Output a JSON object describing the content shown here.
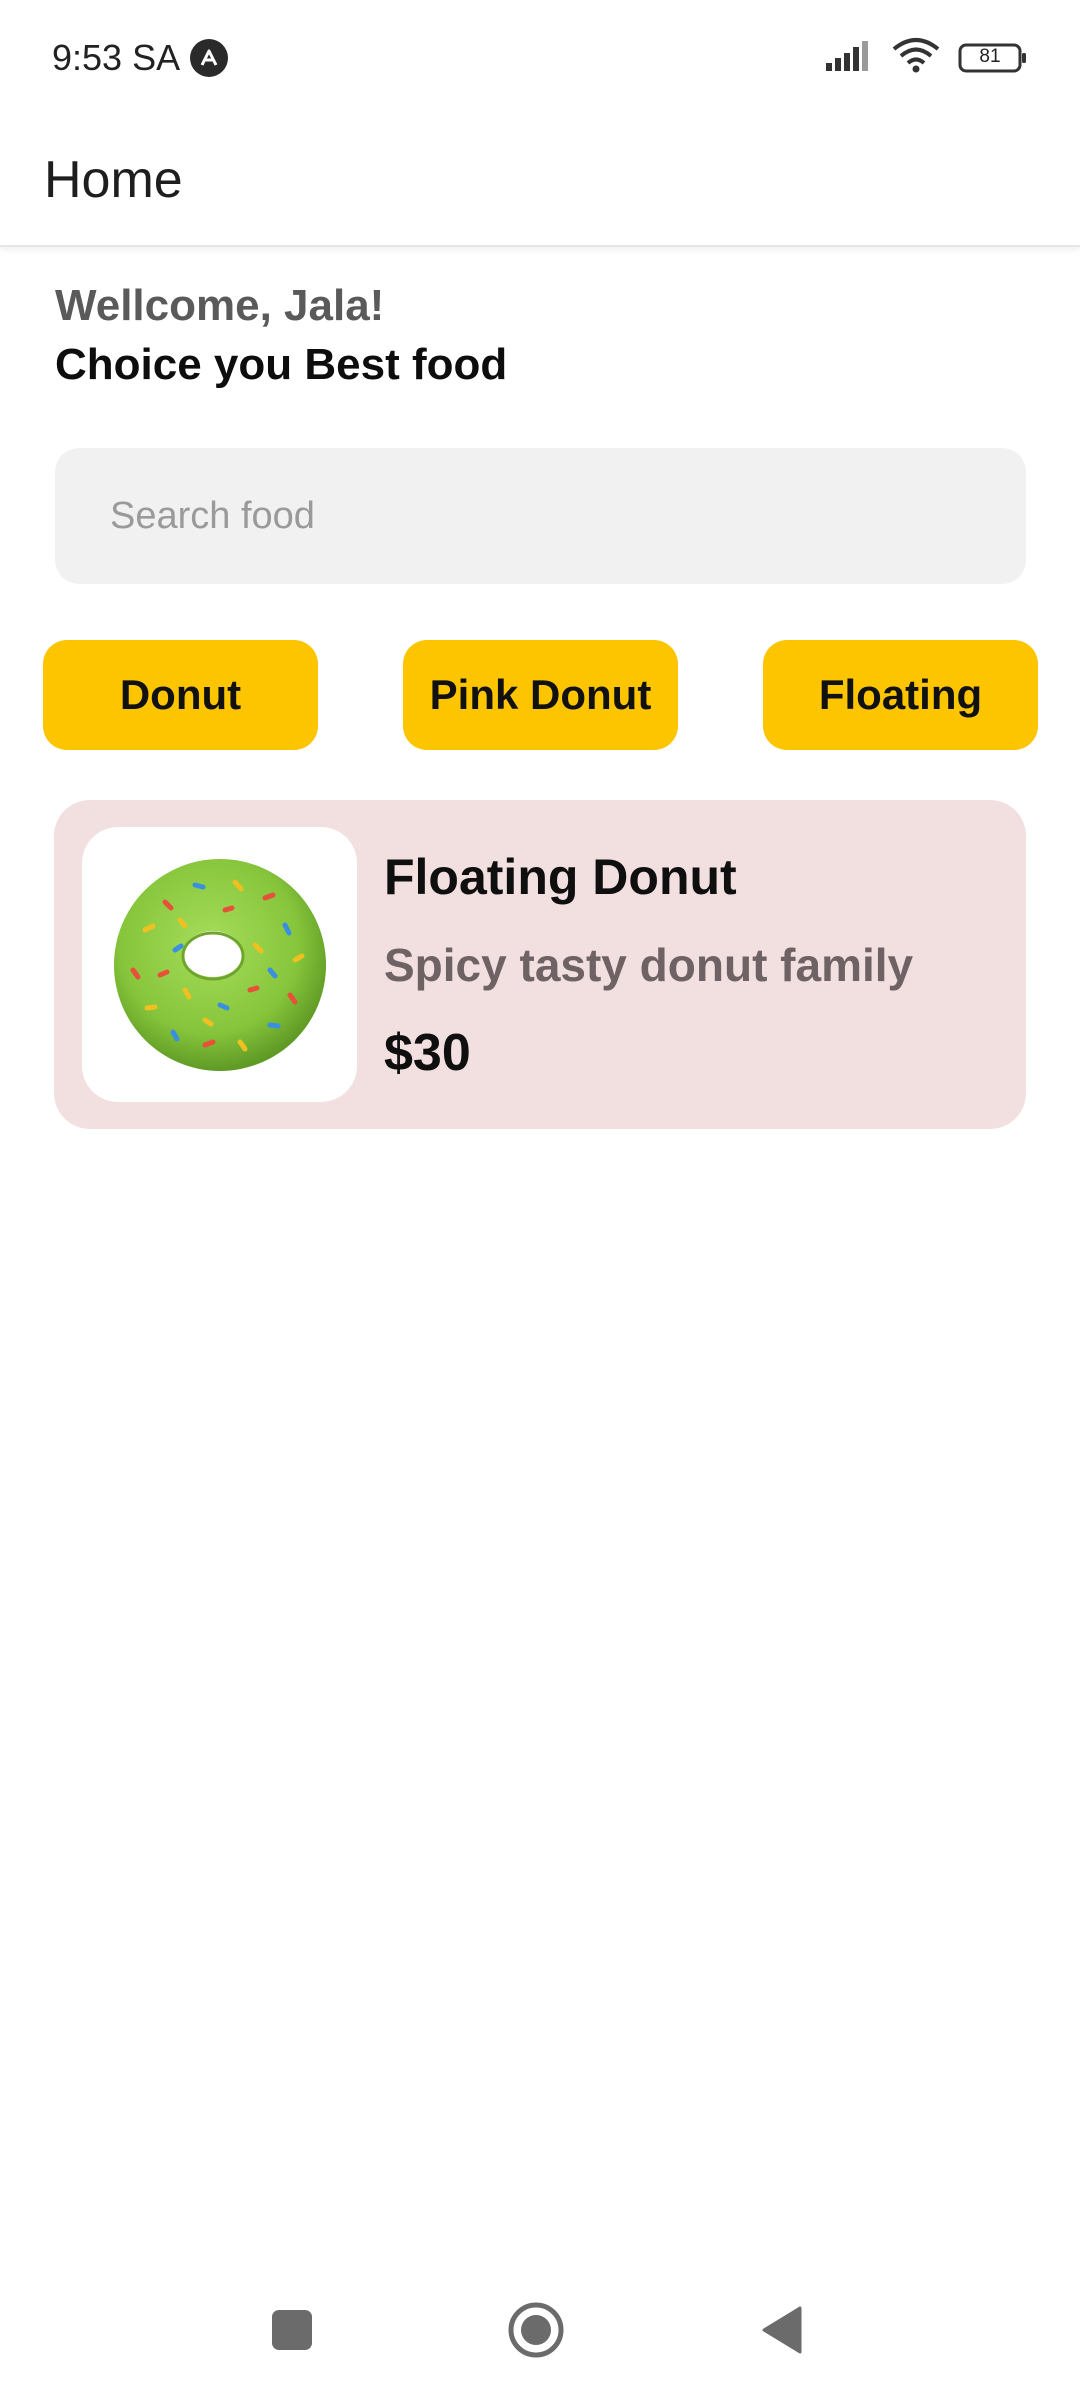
{
  "status_bar": {
    "time": "9:53 SA",
    "battery": "81",
    "icons": [
      "app-indicator-icon",
      "signal-icon",
      "wifi-icon",
      "battery-icon"
    ]
  },
  "app_bar": {
    "title": "Home"
  },
  "greeting": {
    "welcome": "Wellcome, Jala!",
    "subtitle": "Choice you Best food"
  },
  "search": {
    "placeholder": "Search food",
    "value": ""
  },
  "categories": [
    {
      "label": "Donut"
    },
    {
      "label": "Pink Donut"
    },
    {
      "label": "Floating"
    }
  ],
  "food_items": [
    {
      "name": "Floating Donut",
      "description": "Spicy tasty donut family",
      "price": "$30",
      "image_icon": "green-donut-icon"
    }
  ],
  "nav_bar": {
    "icons": [
      "recent-apps-icon",
      "home-icon",
      "back-icon"
    ]
  },
  "colors": {
    "chip": "#fcc500",
    "card_bg": "#f2dfe0",
    "search_bg": "#f1f1f1",
    "description": "#6e6264"
  }
}
